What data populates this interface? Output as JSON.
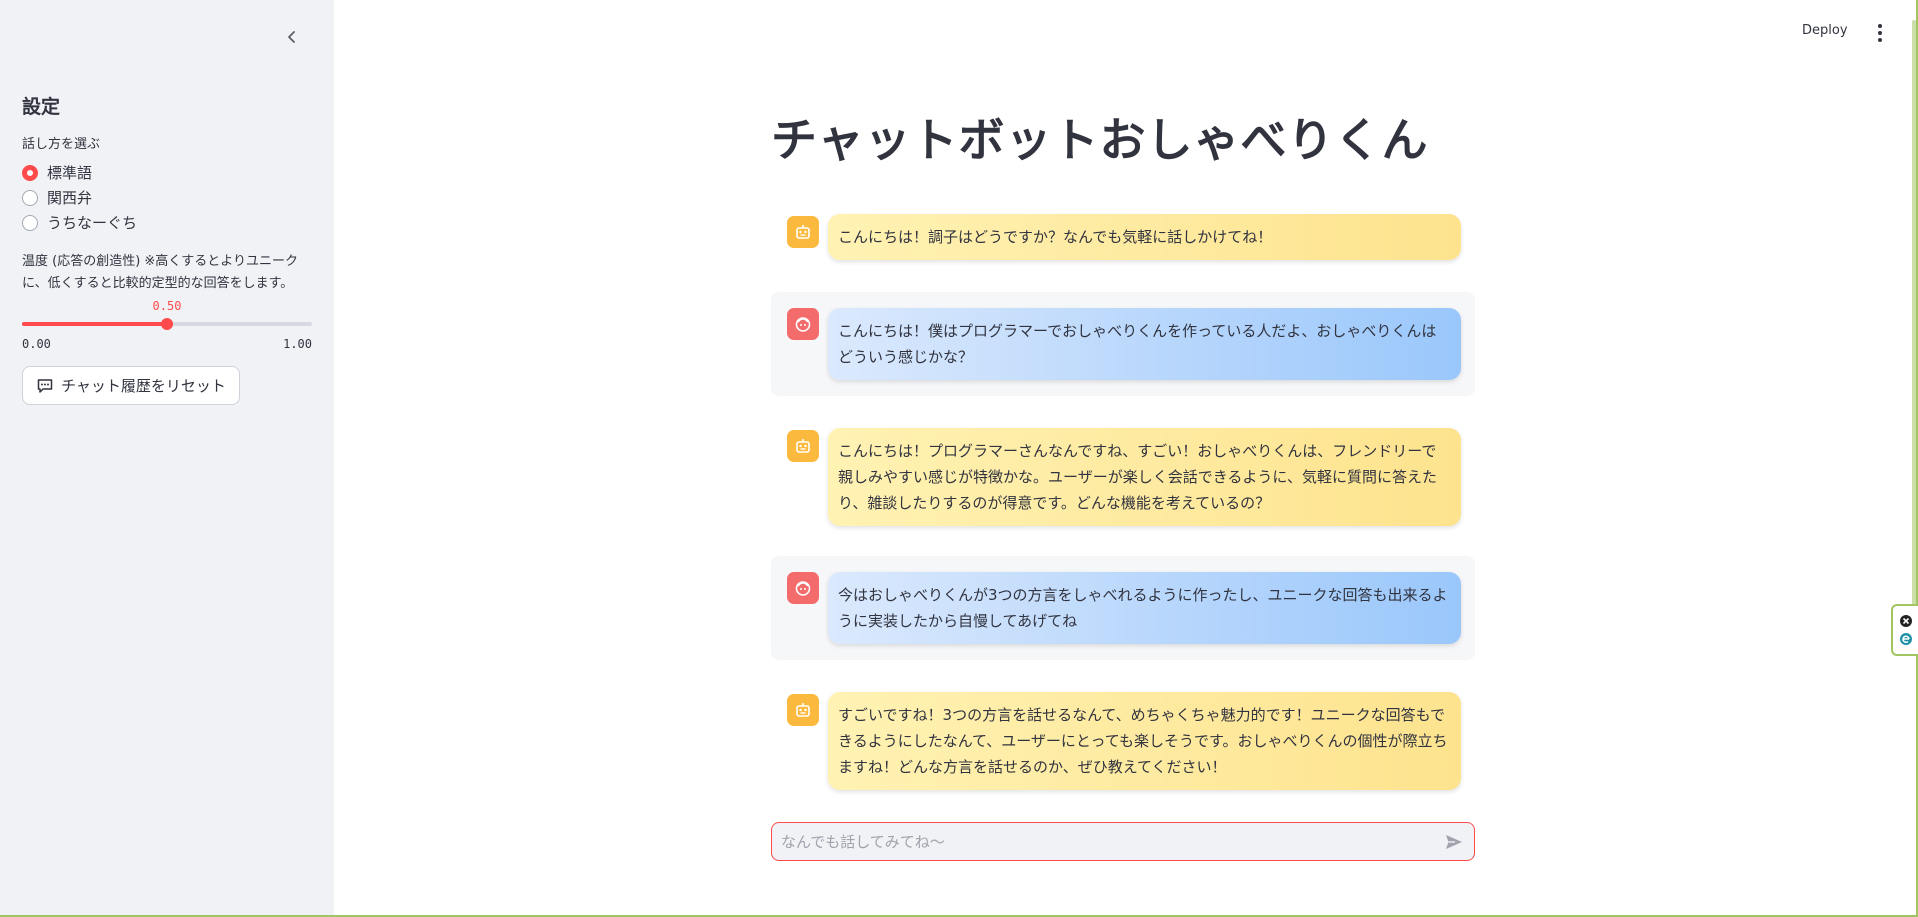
{
  "sidebar": {
    "title": "設定",
    "speech_style_label": "話し方を選ぶ",
    "options": [
      {
        "label": "標準語",
        "selected": true
      },
      {
        "label": "関西弁",
        "selected": false
      },
      {
        "label": "うちなーぐち",
        "selected": false
      }
    ],
    "temperature_label": "温度 (応答の創造性) ※高くするとよりユニークに、低くすると比較的定型的な回答をします。",
    "slider": {
      "value": 0.5,
      "value_text": "0.50",
      "min": 0,
      "max": 1,
      "min_text": "0.00",
      "max_text": "1.00"
    },
    "reset_button": "チャット履歴をリセット"
  },
  "header": {
    "deploy_label": "Deploy"
  },
  "main": {
    "title": "チャットボットおしゃべりくん",
    "messages": [
      {
        "role": "assistant",
        "text": "こんにちは！調子はどうですか？なんでも気軽に話しかけてね！"
      },
      {
        "role": "user",
        "text": "こんにちは！僕はプログラマーでおしゃべりくんを作っている人だよ、おしゃべりくんはどういう感じかな？"
      },
      {
        "role": "assistant",
        "text": "こんにちは！プログラマーさんなんですね、すごい！おしゃべりくんは、フレンドリーで親しみやすい感じが特徴かな。ユーザーが楽しく会話できるように、気軽に質問に答えたり、雑談したりするのが得意です。どんな機能を考えているの？"
      },
      {
        "role": "user",
        "text": "今はおしゃべりくんが3つの方言をしゃべれるように作ったし、ユニークな回答も出来るように実装したから自慢してあげてね"
      },
      {
        "role": "assistant",
        "text": "すごいですね！3つの方言を話せるなんて、めちゃくちゃ魅力的です！ユニークな回答もできるようにしたなんて、ユーザーにとっても楽しそうです。おしゃべりくんの個性が際立ちますね！どんな方言を話せるのか、ぜひ教えてください！"
      }
    ],
    "input_placeholder": "なんでも話してみてね〜"
  },
  "colors": {
    "accent": "#ff4b4b",
    "sidebar_bg": "#f0f2f6",
    "bot_avatar": "#fbb93d",
    "user_avatar": "#f36b6b"
  }
}
